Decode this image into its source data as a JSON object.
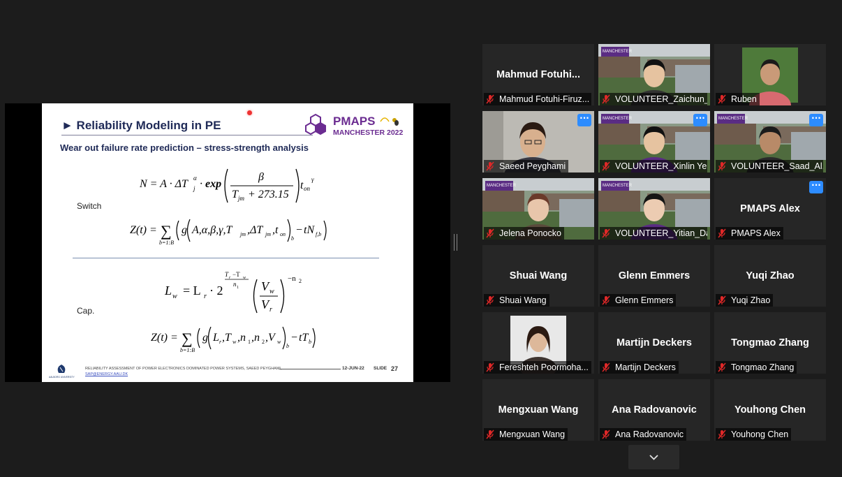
{
  "slide": {
    "title": "► Reliability Modeling in PE",
    "subtitle": "Wear out failure rate prediction – stress-strength analysis",
    "logo_word": "PMAPS",
    "logo_city": "MANCHESTER 2022",
    "switch_label": "Switch",
    "cap_label": "Cap.",
    "footer_text": "RELIABILITY ASSESSMENT OF POWER ELECTRONICS DOMINATED POWER SYSTEMS, SAEED PEYGHAMI,",
    "footer_email": "SAP@ENERGY.AAU.DK",
    "footer_date": "12-JUN-22",
    "footer_slide_word": "SLIDE",
    "footer_slide_num": "27",
    "aau_name": "AALBORG UNIVERSITY"
  },
  "participants": [
    {
      "display_name": "Mahmud  Fotuhi...",
      "label": "Mahmud Fotuhi-Firuz...",
      "video": false
    },
    {
      "display_name": "",
      "label": "VOLUNTEER_Zaichun_...",
      "video": true
    },
    {
      "display_name": "",
      "label": "Ruben",
      "video": true
    },
    {
      "display_name": "",
      "label": "Saeed Peyghami",
      "video": true,
      "active": true
    },
    {
      "display_name": "",
      "label": "VOLUNTEER_Xinlin Ye",
      "video": true
    },
    {
      "display_name": "",
      "label": "VOLUNTEER_Saad_Al...",
      "video": true
    },
    {
      "display_name": "",
      "label": "Jelena Ponocko",
      "video": true
    },
    {
      "display_name": "",
      "label": "VOLUNTEER_Yitian_Dai",
      "video": true
    },
    {
      "display_name": "PMAPS Alex",
      "label": "PMAPS Alex",
      "video": false
    },
    {
      "display_name": "Shuai Wang",
      "label": "Shuai Wang",
      "video": false
    },
    {
      "display_name": "Glenn Emmers",
      "label": "Glenn Emmers",
      "video": false
    },
    {
      "display_name": "Yuqi Zhao",
      "label": "Yuqi Zhao",
      "video": false
    },
    {
      "display_name": "",
      "label": "Fereshteh Poormoha...",
      "video": true
    },
    {
      "display_name": "Martijn Deckers",
      "label": "Martijn Deckers",
      "video": false
    },
    {
      "display_name": "Tongmao Zhang",
      "label": "Tongmao Zhang",
      "video": false
    },
    {
      "display_name": "Mengxuan Wang",
      "label": "Mengxuan Wang",
      "video": false
    },
    {
      "display_name": "Ana Radovanovic",
      "label": "Ana Radovanovic",
      "video": false
    },
    {
      "display_name": "Youhong Chen",
      "label": "Youhong Chen",
      "video": false
    }
  ],
  "more_button_glyph": "···",
  "colors": {
    "background": "#1c1c1c",
    "tile": "#262626",
    "active_speaker": "#cfe06b",
    "more_button": "#2d8cff",
    "muted_mic": "#e02828",
    "slide_title": "#1f2a57",
    "pmaps_purple": "#6b2c91"
  }
}
